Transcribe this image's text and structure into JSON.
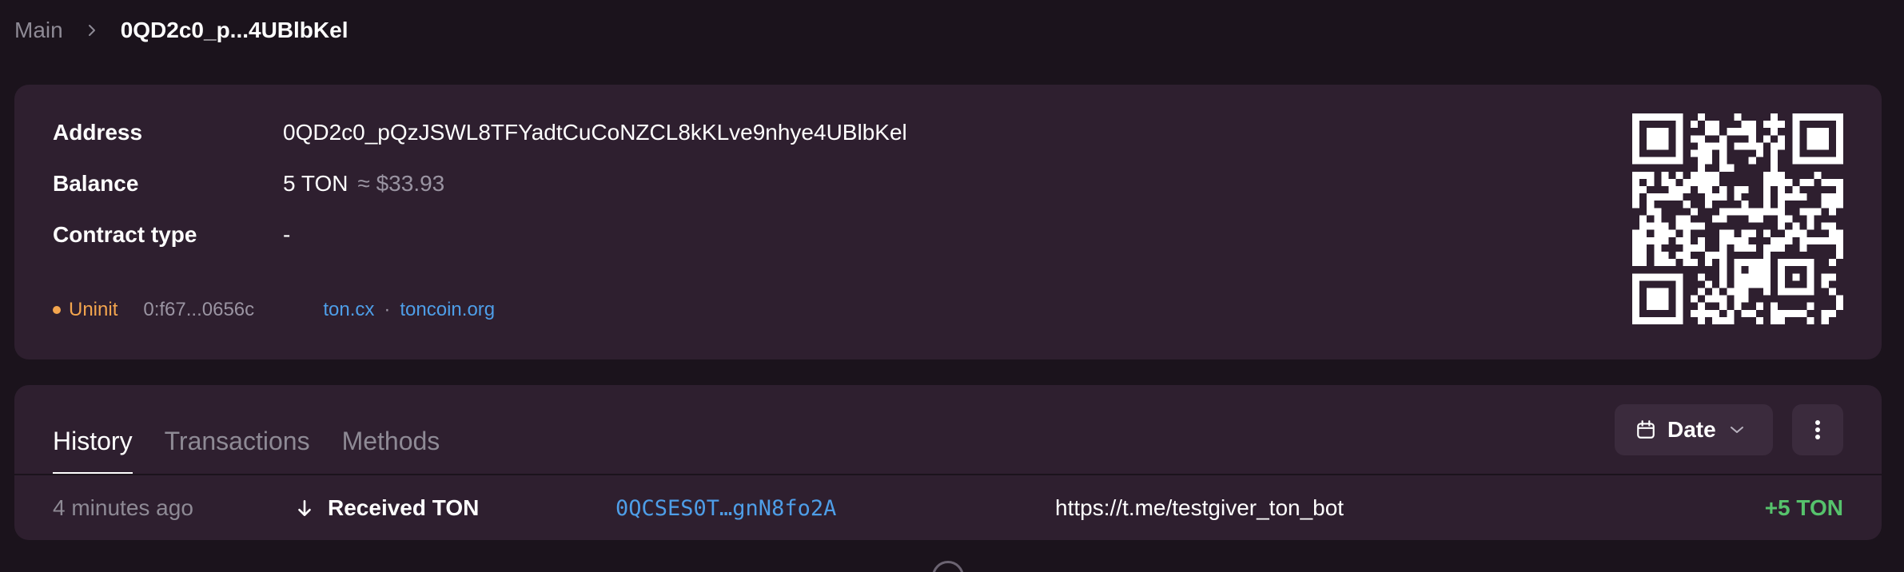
{
  "breadcrumb": {
    "root": "Main",
    "current": "0QD2c0_p...4UBlbKel"
  },
  "account": {
    "address_label": "Address",
    "address": "0QD2c0_pQzJSWL8TFYadtCuCoNZCL8kKLve9nhye4UBlbKel",
    "balance_label": "Balance",
    "balance": "5 TON",
    "balance_usd": "≈ $33.93",
    "contract_label": "Contract type",
    "contract_type": "-",
    "status": "Uninit",
    "raw_address": "0:f67...0656c",
    "links": [
      "ton.cx",
      "toncoin.org"
    ],
    "link_separator": "·"
  },
  "history": {
    "tabs": [
      "History",
      "Transactions",
      "Methods"
    ],
    "active_tab": "History",
    "date_button": "Date",
    "rows": [
      {
        "time": "4 minutes ago",
        "type": "Received TON",
        "address": "0QCSES0T…gnN8fo2A",
        "comment": "https://t.me/testgiver_ton_bot",
        "amount": "+5 TON"
      }
    ]
  },
  "colors": {
    "background": "#1b131c",
    "card": "#2e1f2f",
    "status_uninit": "#f3a54e",
    "link": "#4e9ee8",
    "positive": "#56c26c"
  }
}
